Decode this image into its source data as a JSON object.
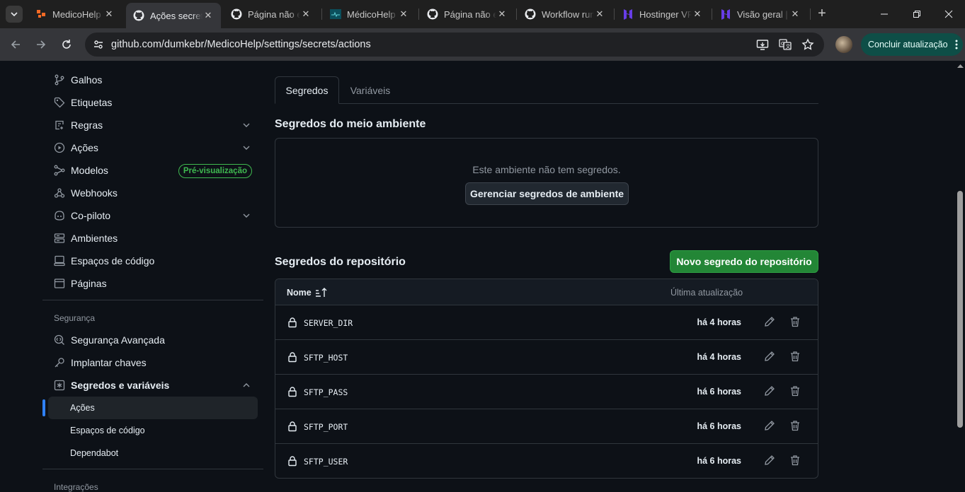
{
  "browser": {
    "tabs": [
      {
        "label": "MedicoHelp",
        "favicon": "medicohelp-icon"
      },
      {
        "label": "Ações secretas",
        "favicon": "github-icon",
        "active": true
      },
      {
        "label": "Página não encontrada",
        "favicon": "github-icon"
      },
      {
        "label": "MédicoHelp",
        "favicon": "medicohelp-app-icon"
      },
      {
        "label": "Página não encontrada",
        "favicon": "github-icon"
      },
      {
        "label": "Workflow runs",
        "favicon": "github-icon"
      },
      {
        "label": "Hostinger VPS",
        "favicon": "hostinger-icon"
      },
      {
        "label": "Visão geral | Hostinger",
        "favicon": "hostinger-icon"
      }
    ],
    "url": "github.com/dumkebr/MedicoHelp/settings/secrets/actions",
    "update_button": "Concluir atualização"
  },
  "sidebar": {
    "items": [
      {
        "label": "Galhos",
        "icon": "branch-icon"
      },
      {
        "label": "Etiquetas",
        "icon": "tag-icon"
      },
      {
        "label": "Regras",
        "icon": "rules-icon",
        "chevron": "down"
      },
      {
        "label": "Ações",
        "icon": "play-icon",
        "chevron": "down"
      },
      {
        "label": "Modelos",
        "icon": "models-icon",
        "badge": "Pré-visualização"
      },
      {
        "label": "Webhooks",
        "icon": "webhook-icon"
      },
      {
        "label": "Co-piloto",
        "icon": "copilot-icon",
        "chevron": "down"
      },
      {
        "label": "Ambientes",
        "icon": "server-icon"
      },
      {
        "label": "Espaços de código",
        "icon": "codespaces-icon"
      },
      {
        "label": "Páginas",
        "icon": "browser-icon"
      }
    ],
    "security_heading": "Segurança",
    "security_items": [
      {
        "label": "Segurança Avançada",
        "icon": "codescan-icon"
      },
      {
        "label": "Implantar chaves",
        "icon": "key-icon"
      },
      {
        "label": "Segredos e variáveis",
        "icon": "asterisk-icon",
        "chevron": "up"
      }
    ],
    "sub_items": [
      "Ações",
      "Espaços de código",
      "Dependabot"
    ],
    "integrations_heading": "Integrações"
  },
  "main": {
    "tabs": [
      "Segredos",
      "Variáveis"
    ],
    "env_heading": "Segredos do meio ambiente",
    "env_empty": "Este ambiente não tem segredos.",
    "env_button": "Gerenciar segredos de ambiente",
    "repo_heading": "Segredos do repositório",
    "new_secret_button": "Novo segredo do repositório",
    "table": {
      "col_name": "Nome",
      "col_updated": "Última atualização",
      "rows": [
        {
          "name": "SERVER_DIR",
          "updated": "há 4 horas"
        },
        {
          "name": "SFTP_HOST",
          "updated": "há 4 horas"
        },
        {
          "name": "SFTP_PASS",
          "updated": "há 6 horas"
        },
        {
          "name": "SFTP_PORT",
          "updated": "há 6 horas"
        },
        {
          "name": "SFTP_USER",
          "updated": "há 6 horas"
        }
      ]
    }
  },
  "colors": {
    "accent_green": "#238636",
    "badge_green": "#3fb950",
    "active_blue": "#2f81f7",
    "update_bg": "#0e4e47"
  }
}
